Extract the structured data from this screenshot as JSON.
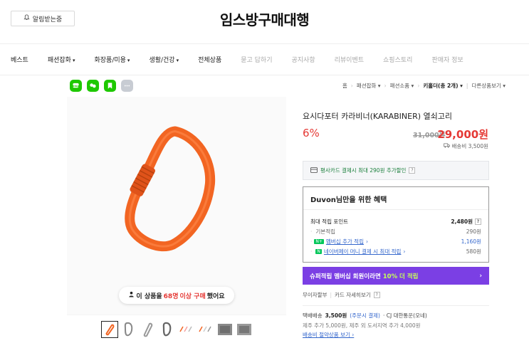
{
  "header": {
    "notify_label": "알림받는중",
    "site_title": "임스방구매대행"
  },
  "nav": {
    "items": [
      {
        "label": "베스트",
        "caret": false,
        "light": false
      },
      {
        "label": "패션잡화",
        "caret": true,
        "light": false
      },
      {
        "label": "화장품/미용",
        "caret": true,
        "light": false
      },
      {
        "label": "생활/건강",
        "caret": true,
        "light": false
      },
      {
        "label": "전체상품",
        "caret": false,
        "light": false
      },
      {
        "label": "묻고 답하기",
        "caret": false,
        "light": true
      },
      {
        "label": "공지사항",
        "caret": false,
        "light": true
      },
      {
        "label": "리뷰이벤트",
        "caret": false,
        "light": true
      },
      {
        "label": "쇼핑스토리",
        "caret": false,
        "light": true
      },
      {
        "label": "판매자 정보",
        "caret": false,
        "light": true
      }
    ]
  },
  "share_icons": [
    {
      "name": "blog-share-icon",
      "color": "#1ec800"
    },
    {
      "name": "talk-share-icon",
      "color": "#1ec800"
    },
    {
      "name": "bookmark-share-icon",
      "color": "#1ec800"
    },
    {
      "name": "more-share-icon",
      "color": "#c8ccd3"
    }
  ],
  "breadcrumb": {
    "home": "홈",
    "cat1": "패션잡화",
    "cat2": "패션소품",
    "cat3": "키홀더(총 2개)",
    "other": "다른상품보기"
  },
  "product": {
    "name": "요시다포터 카라비너(KARABINER) 열쇠고리",
    "discount": "6%",
    "original_price": "31,000원",
    "sale_price": "29,000원",
    "shipping_fee": "배송비 3,500원",
    "buy_badge": {
      "prefix": "이 상품을",
      "count": "68명",
      "middle": "이상 구매",
      "suffix": "했어요"
    }
  },
  "card_promo": "평사카드 결제시 최대 290원 추가할인",
  "benefit": {
    "title": "Duvon님만을 위한 혜택",
    "max_points_label": "최대 적립 포인트",
    "max_points_value": "2,480원",
    "basic_label": "기본적립",
    "basic_value": "290원",
    "membership_label": "멤버십 추가 적립",
    "membership_value": "1,160원",
    "naverpay_label": "네이버페이 머니 결제 시 최대 적립",
    "naverpay_value": "580원"
  },
  "super_bar": {
    "prefix": "슈퍼적립",
    "middle": "멤버십 회원이라면",
    "highlight": "10% 더 적립",
    "arrow": "›"
  },
  "installment": {
    "label": "무이자할부",
    "link": "카드 자세히보기"
  },
  "shipping": {
    "label": "택배배송",
    "price": "3,500원",
    "note": "(주문시 결제)",
    "carrier": "· CJ 대한통운(오네)",
    "extra": "제주 추가 5,000원, 제주 외 도서지역 추가 4,000원",
    "link": "배송비 절약상품 보기 ›"
  },
  "colors": {
    "accent_red": "#e53935",
    "naver_green": "#03c75a",
    "purple": "#7b3fe4",
    "carabiner_orange": "#f26522"
  }
}
